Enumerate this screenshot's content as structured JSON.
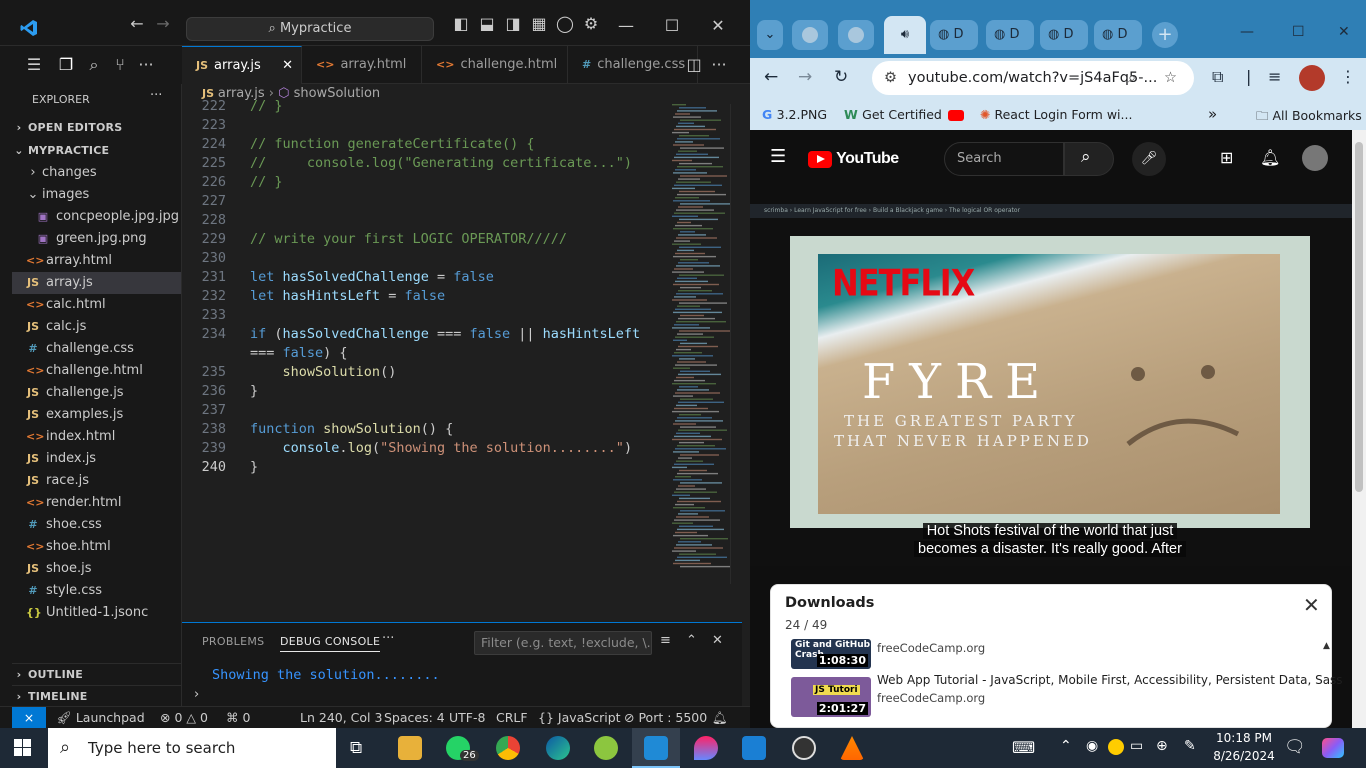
{
  "vscode": {
    "search_text": "Mypractice",
    "explorer_label": "EXPLORER",
    "sections": {
      "open_editors": "OPEN EDITORS",
      "project": "MYPRACTICE",
      "outline": "OUTLINE",
      "timeline": "TIMELINE"
    },
    "tree": [
      {
        "label": "changes",
        "type": "folder",
        "state": "closed"
      },
      {
        "label": "images",
        "type": "folder",
        "state": "open"
      },
      {
        "label": "concpeople.jpg.jpg",
        "type": "img"
      },
      {
        "label": "green.jpg.png",
        "type": "img"
      },
      {
        "label": "array.html",
        "type": "html"
      },
      {
        "label": "array.js",
        "type": "js",
        "selected": true
      },
      {
        "label": "calc.html",
        "type": "html"
      },
      {
        "label": "calc.js",
        "type": "js"
      },
      {
        "label": "challenge.css",
        "type": "css"
      },
      {
        "label": "challenge.html",
        "type": "html"
      },
      {
        "label": "challenge.js",
        "type": "js"
      },
      {
        "label": "examples.js",
        "type": "js"
      },
      {
        "label": "index.html",
        "type": "html"
      },
      {
        "label": "index.js",
        "type": "js"
      },
      {
        "label": "race.js",
        "type": "js"
      },
      {
        "label": "render.html",
        "type": "html"
      },
      {
        "label": "shoe.css",
        "type": "css"
      },
      {
        "label": "shoe.html",
        "type": "html"
      },
      {
        "label": "shoe.js",
        "type": "js"
      },
      {
        "label": "style.css",
        "type": "css"
      },
      {
        "label": "Untitled-1.jsonc",
        "type": "json"
      }
    ],
    "tabs": [
      {
        "label": "array.js",
        "type": "js",
        "active": true
      },
      {
        "label": "array.html",
        "type": "html"
      },
      {
        "label": "challenge.html",
        "type": "html"
      },
      {
        "label": "challenge.css",
        "type": "css"
      }
    ],
    "breadcrumb": {
      "file": "array.js",
      "symbol": "showSolution"
    },
    "code_lines": [
      {
        "n": "222",
        "text": "// }"
      },
      {
        "n": "223",
        "text": ""
      },
      {
        "n": "224",
        "text": "// function generateCertificate() {"
      },
      {
        "n": "225",
        "text": "//     console.log(\"Generating certificate...\")"
      },
      {
        "n": "226",
        "text": "// }"
      },
      {
        "n": "227",
        "text": ""
      },
      {
        "n": "228",
        "text": ""
      },
      {
        "n": "229",
        "text": "// write your first LOGIC OPERATOR/////"
      },
      {
        "n": "230",
        "text": ""
      },
      {
        "n": "231",
        "text": "let hasSolvedChallenge = false"
      },
      {
        "n": "232",
        "text": "let hasHintsLeft = false"
      },
      {
        "n": "233",
        "text": ""
      },
      {
        "n": "234",
        "text": "if (hasSolvedChallenge === false || hasHintsLeft"
      },
      {
        "n": "",
        "text": "=== false) {"
      },
      {
        "n": "235",
        "text": "    showSolution()"
      },
      {
        "n": "236",
        "text": "}"
      },
      {
        "n": "237",
        "text": ""
      },
      {
        "n": "238",
        "text": "function showSolution() {"
      },
      {
        "n": "239",
        "text": "    console.log(\"Showing the solution........\")"
      },
      {
        "n": "240",
        "text": "}"
      }
    ],
    "panel": {
      "tab_problems": "PROBLEMS",
      "tab_debug": "DEBUG CONSOLE",
      "filter_placeholder": "Filter (e.g. text, !exclude, \\...",
      "output": "Showing the solution........"
    },
    "status": {
      "launchpad": "Launchpad",
      "errors": "0",
      "warnings": "0",
      "ports": "0",
      "position": "Ln 240, Col 3",
      "spaces": "Spaces: 4",
      "encoding": "UTF-8",
      "eol": "CRLF",
      "language": "JavaScript",
      "port": "Port : 5500"
    }
  },
  "browser": {
    "tab_letters": [
      "D",
      "D",
      "D",
      "D"
    ],
    "url": "youtube.com/watch?v=jS4aFq5-...",
    "bookmarks": [
      "3.2.PNG",
      "Get Certified",
      "React Login Form wi...",
      "All Bookmarks"
    ],
    "youtube": {
      "logo": "YouTube",
      "search_placeholder": "Search",
      "scrim_header": "scrimba  ›  Learn JavaScript for free  ›  Build a Blackjack game  ›  The logical OR operator",
      "netflix": "NETFLIX",
      "title": "FYRE",
      "tagline1": "THE GREATEST PARTY",
      "tagline2": "THAT NEVER HAPPENED",
      "caption1": "Hot Shots festival of the world that just",
      "caption2": "becomes a disaster. It's really good. After"
    },
    "downloads": {
      "title": "Downloads",
      "count": "24 / 49",
      "items": [
        {
          "thumb_title": "Git and GitHub Crash",
          "duration": "1:08:30",
          "title": "",
          "source": "freeCodeCamp.org"
        },
        {
          "thumb_title": "JS Tutori",
          "duration": "2:01:27",
          "title": "Web App Tutorial - JavaScript, Mobile First, Accessibility, Persistent Data, Sass",
          "source": "freeCodeCamp.org"
        }
      ]
    }
  },
  "taskbar": {
    "search_placeholder": "Type here to search",
    "whatsapp_badge": "26",
    "time": "10:18 PM",
    "date": "8/26/2024"
  }
}
